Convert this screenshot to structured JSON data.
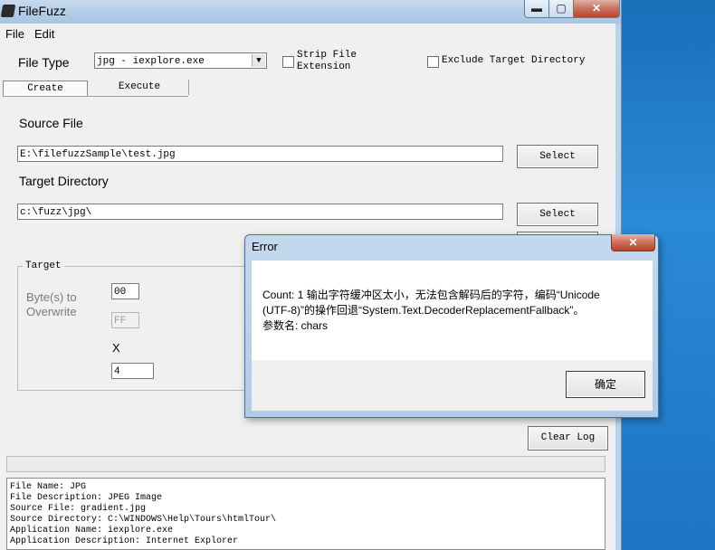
{
  "window": {
    "title": "FileFuzz",
    "minimize": "▬",
    "maximize": "▢",
    "close": "✕"
  },
  "menu": [
    "File",
    "Edit"
  ],
  "file_type": {
    "label": "File Type",
    "value": "jpg - iexplore.exe"
  },
  "strip_file_extension": {
    "line1": "Strip File",
    "line2": "Extension",
    "checked": false
  },
  "exclude_target_directory": {
    "label": "Exclude Target Directory",
    "checked": false
  },
  "tabs": [
    {
      "label": "Create",
      "active": true
    },
    {
      "label": "Execute",
      "active": false
    }
  ],
  "source_file": {
    "label": "Source File",
    "value": "E:\\filefuzzSample\\test.jpg",
    "button": "Select"
  },
  "target_directory": {
    "label": "Target Directory",
    "value": "c:\\fuzz\\jpg\\",
    "button": "Select"
  },
  "target_group": {
    "title": "Target",
    "bytes_label_line1": "Byte(s) to",
    "bytes_label_line2": "Overwrite",
    "byte_value": "00",
    "byte_value_disabled": "FF",
    "x_label": "X",
    "count_value": "4"
  },
  "clear_log": "Clear Log",
  "log_lines": [
    "File Name: JPG",
    "File Description: JPEG Image",
    "Source File: gradient.jpg",
    "Source Directory: C:\\WINDOWS\\Help\\Tours\\htmlTour\\",
    "Application Name: iexplore.exe",
    "Application Description: Internet Explorer"
  ],
  "dialog": {
    "title": "Error",
    "close": "✕",
    "message_line1": "Count: 1 输出字符缓冲区太小，无法包含解码后的字符，编码“Unicode",
    "message_line2": "(UTF-8)”的操作回退“System.Text.DecoderReplacementFallback”。",
    "message_line3": "参数名: chars",
    "ok_button": "确定"
  },
  "colors": {
    "desktop": "#1f78c7",
    "window_bg": "#f0f0f0",
    "close_red": "#c7503a"
  }
}
